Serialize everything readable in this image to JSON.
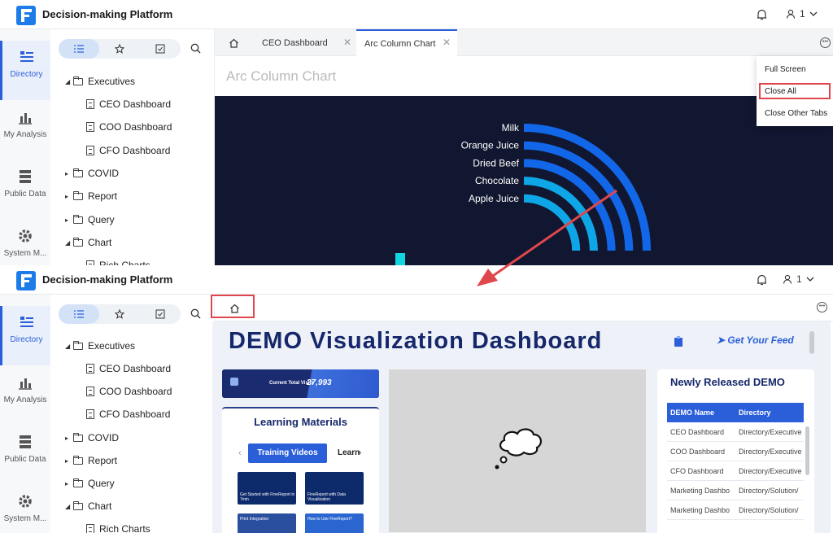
{
  "app": {
    "title": "Decision-making Platform",
    "user_count": "1"
  },
  "nav": [
    {
      "label": "Directory"
    },
    {
      "label": "My Analysis"
    },
    {
      "label": "Public Data"
    },
    {
      "label": "System M..."
    }
  ],
  "tree": {
    "items": [
      {
        "label": "Executives"
      },
      {
        "label": "CEO Dashboard"
      },
      {
        "label": "COO Dashboard"
      },
      {
        "label": "CFO Dashboard"
      },
      {
        "label": "COVID"
      },
      {
        "label": "Report"
      },
      {
        "label": "Query"
      },
      {
        "label": "Chart"
      },
      {
        "label": "Rich Charts"
      }
    ]
  },
  "tabs": [
    {
      "label": "CEO Dashboard"
    },
    {
      "label": "Arc Column Chart"
    }
  ],
  "context_menu": {
    "full_screen": "Full Screen",
    "close_all": "Close All",
    "close_other": "Close Other Tabs"
  },
  "chart_view": {
    "title": "Arc Column Chart"
  },
  "chart_data": {
    "type": "bar",
    "title": "",
    "categories": [
      "Milk",
      "Orange Juice",
      "Dried Beef",
      "Chocolate",
      "Apple Juice"
    ]
  },
  "dashboard": {
    "title": "DEMO Visualization Dashboard",
    "feed": "➤ Get Your Feed",
    "kpi_label": "Current Total Visits",
    "kpi_value": "27,993",
    "learning": {
      "title": "Learning Materials",
      "tab_active": "Training Videos",
      "tab_next": "Learn",
      "thumbs": [
        {
          "text": "Get Started with FineReport in 7min"
        },
        {
          "text": "FineReport with Data Visualization"
        },
        {
          "text": "Print Integration"
        },
        {
          "text": "How to Use FineReport?"
        }
      ]
    },
    "newly": {
      "title": "Newly Released DEMO",
      "col1": "DEMO Name",
      "col2": "Directory",
      "rows": [
        {
          "name": "CEO Dashboard",
          "dir": "Directory/Executive"
        },
        {
          "name": "COO Dashboard",
          "dir": "Directory/Executive"
        },
        {
          "name": "CFO Dashboard",
          "dir": "Directory/Executive"
        },
        {
          "name": "Marketing Dashbo",
          "dir": "Directory/Solution/"
        },
        {
          "name": "Marketing Dashbo",
          "dir": "Directory/Solution/"
        }
      ]
    }
  }
}
